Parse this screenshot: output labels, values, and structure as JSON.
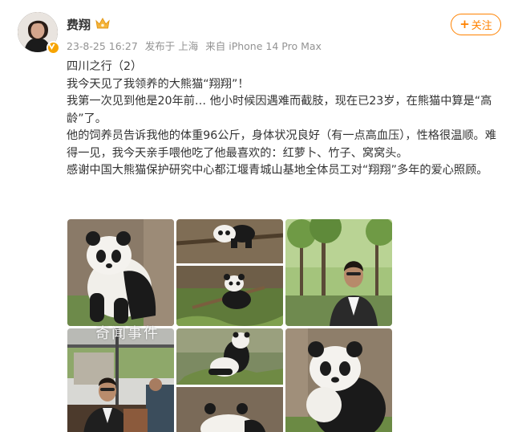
{
  "user": {
    "name": "费翔",
    "time": "23-8-25 16:27",
    "location": "发布于 上海",
    "device": "来自 iPhone 14 Pro Max"
  },
  "follow_label": "关注",
  "post": {
    "lines": [
      "四川之行（2）",
      "我今天见了我领养的大熊猫“翔翔”！",
      "我第一次见到他是20年前… 他小时候因遇难而截肢，现在已23岁，在熊猫中算是“高龄”了。",
      "他的饲养员告诉我他的体重96公斤，身体状况良好（有一点高血压），性格很温顺。难得一见，我今天亲手喂他吃了他最喜欢的：红萝卜、竹子、窝窝头。",
      "感谢中国大熊猫保护研究中心都江堰青城山基地全体员工对“翔翔”多年的爱心照顾。"
    ]
  },
  "watermark": "奇闻事件",
  "icons": {
    "verified": "verified-badge-icon",
    "crown": "vip-crown-icon",
    "plus": "plus-icon"
  },
  "colors": {
    "accent": "#ff8200",
    "meta_text": "#939393",
    "body_text": "#333333",
    "verified": "#f7a400"
  }
}
